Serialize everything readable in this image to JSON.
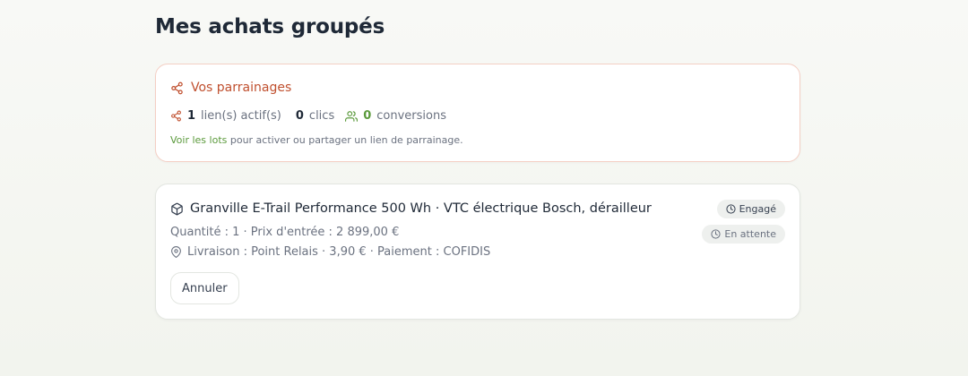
{
  "page": {
    "title": "Mes achats groupés"
  },
  "referrals": {
    "title": "Vos parrainages",
    "active_links_count": "1",
    "active_links_label": "lien(s) actif(s)",
    "clicks_count": "0",
    "clicks_label": "clics",
    "conversions_count": "0",
    "conversions_label": "conversions",
    "hint_link": "Voir les lots",
    "hint_text": " pour activer ou partager un lien de parrainage.",
    "accent_color": "#c0502f",
    "green_color": "#5b9a3c"
  },
  "order": {
    "product_name": "Granville E-Trail Performance 500 Wh · VTC électrique Bosch, dérailleur",
    "quantity_line": "Quantité : 1 · Prix d'entrée : 2 899,00 €",
    "delivery_line": "Livraison : Point Relais · 3,90 € · Paiement : COFIDIS",
    "badge_engaged": "Engagé",
    "badge_pending": "En attente",
    "cancel_label": "Annuler"
  },
  "icons": {
    "share": "share-icon",
    "users": "users-icon",
    "package": "package-icon",
    "map_pin": "map-pin-icon",
    "clock": "clock-icon"
  }
}
